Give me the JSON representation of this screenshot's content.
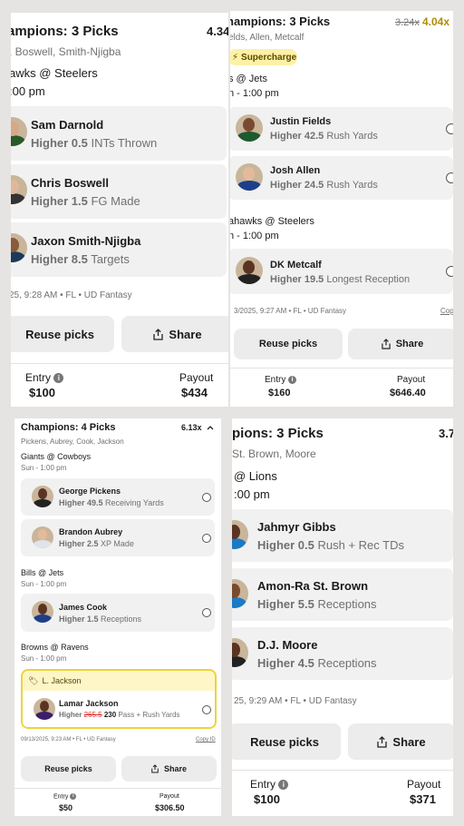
{
  "tl": {
    "title": "ampions: 3 Picks",
    "multiplier": "4.34",
    "players_line": ", Boswell, Smith-Njigba",
    "game": "awks @ Steelers",
    "time": ":00 pm",
    "picks": [
      {
        "name": "Sam Darnold",
        "line": "Higher 0.5",
        "stat": "INTs Thrown"
      },
      {
        "name": "Chris Boswell",
        "line": "Higher 1.5",
        "stat": "FG Made"
      },
      {
        "name": "Jaxon Smith-Njigba",
        "line": "Higher 8.5",
        "stat": "Targets"
      }
    ],
    "footer": "25, 9:28 AM • FL • UD Fantasy",
    "reuse": "Reuse picks",
    "share": "Share",
    "entry_label": "Entry",
    "entry_value": "$100",
    "payout_label": "Payout",
    "payout_value": "$434"
  },
  "tr": {
    "title": "hampions: 3 Picks",
    "multiplier_old": "3.24x",
    "multiplier_new": "4.04x",
    "players_line": "elds, Allen, Metcalf",
    "badge": "Supercharge",
    "game1": "s @ Jets",
    "time1": "n - 1:00 pm",
    "picks1": [
      {
        "name": "Justin Fields",
        "line": "Higher 42.5",
        "stat": "Rush Yards"
      },
      {
        "name": "Josh Allen",
        "line": "Higher 24.5",
        "stat": "Rush Yards"
      }
    ],
    "game2": "ahawks @ Steelers",
    "time2": "n - 1:00 pm",
    "picks2": [
      {
        "name": "DK Metcalf",
        "line": "Higher 19.5",
        "stat": "Longest Reception"
      }
    ],
    "footer": "3/2025, 9:27 AM • FL • UD Fantasy",
    "copy": "Cop",
    "reuse": "Reuse picks",
    "share": "Share",
    "entry_label": "Entry",
    "entry_value": "$160",
    "payout_label": "Payout",
    "payout_value": "$646.40"
  },
  "bl": {
    "title": "Champions: 4 Picks",
    "multiplier": "6.13x",
    "players_line": "Pickens, Aubrey, Cook, Jackson",
    "game1": "Giants @ Cowboys",
    "time1": "Sun - 1:00 pm",
    "picks1": [
      {
        "name": "George Pickens",
        "line": "Higher 49.5",
        "stat": "Receiving Yards"
      },
      {
        "name": "Brandon Aubrey",
        "line": "Higher 2.5",
        "stat": "XP Made"
      }
    ],
    "game2": "Bills @ Jets",
    "time2": "Sun - 1:00 pm",
    "picks2": [
      {
        "name": "James Cook",
        "line": "Higher 1.5",
        "stat": "Receptions"
      }
    ],
    "game3": "Browns @ Ravens",
    "time3": "Sun - 1:00 pm",
    "boost_tag": "L. Jackson",
    "boost_pick": {
      "name": "Lamar Jackson",
      "higher": "Higher",
      "old": "265.5",
      "new": "230",
      "stat": "Pass + Rush Yards"
    },
    "footer": "09/13/2025, 9:23 AM • FL • UD Fantasy",
    "copy": "Copy ID",
    "reuse": "Reuse picks",
    "share": "Share",
    "entry_label": "Entry",
    "entry_value": "$50",
    "payout_label": "Payout",
    "payout_value": "$306.50"
  },
  "br": {
    "title": "pions: 3 Picks",
    "multiplier": "3.7",
    "players_line": "St. Brown, Moore",
    "game": "@ Lions",
    "time": ":00 pm",
    "picks": [
      {
        "name": "Jahmyr Gibbs",
        "line": "Higher 0.5",
        "stat": "Rush + Rec TDs"
      },
      {
        "name": "Amon-Ra St. Brown",
        "line": "Higher 5.5",
        "stat": "Receptions"
      },
      {
        "name": "D.J. Moore",
        "line": "Higher 4.5",
        "stat": "Receptions"
      }
    ],
    "footer": "25, 9:29 AM • FL • UD Fantasy",
    "reuse": "Reuse picks",
    "share": "Share",
    "entry_label": "Entry",
    "entry_value": "$100",
    "payout_label": "Payout",
    "payout_value": "$371"
  },
  "colors": {
    "accent_gold": "#b08d00",
    "boost_border": "#f0d23a",
    "strike_red": "#d33333"
  }
}
